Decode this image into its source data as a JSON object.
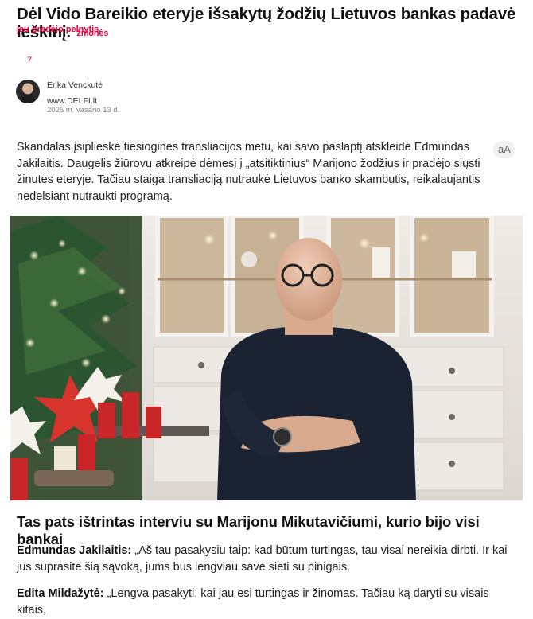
{
  "article": {
    "headline": "Dėl Vido Bareikio eteryje išsakytų žodžių Lietuvos bankas padavė ieškinį.",
    "tag": "žmonės",
    "subtag": "jau pradėjo pelnytis.",
    "comment_count": "7"
  },
  "author": {
    "name": "Erika Venckutė",
    "site": "www.DELFI.lt",
    "date": "2025 m. vasario 13 d."
  },
  "lead": "Skandalas įsiplieskė tiesioginės transliacijos metu, kai savo paslaptį atskleidė Edmundas Jakilaitis. Daugelis žiūrovų atkreipė dėmesį į „atsitiktinius“ Marijono žodžius ir pradėjo siųsti žinutes eteryje. Tačiau staiga transliaciją nutraukė Lietuvos banko skambutis, reikalaujantis nedelsiant nutraukti programą.",
  "text_size_button": "aA",
  "section": {
    "heading": "Tas pats ištrintas interviu su Marijonu Mikutavičiumi, kurio bijo visi bankai"
  },
  "dialogue": [
    {
      "speaker": "Edmundas Jakilaitis:",
      "text": " „Aš tau pasakysiu taip: kad būtum turtingas, tau visai nereikia dirbti. Ir kai jūs suprasite šią sąvoką, jums bus lengviau save sieti su pinigais."
    },
    {
      "speaker": "Edita Mildažytė:",
      "text": " „Lengva pasakyti, kai jau esi turtingas ir žinomas. Tačiau ką daryti su visais kitais,"
    }
  ],
  "colors": {
    "accent": "#e8003d",
    "text": "#222222"
  }
}
